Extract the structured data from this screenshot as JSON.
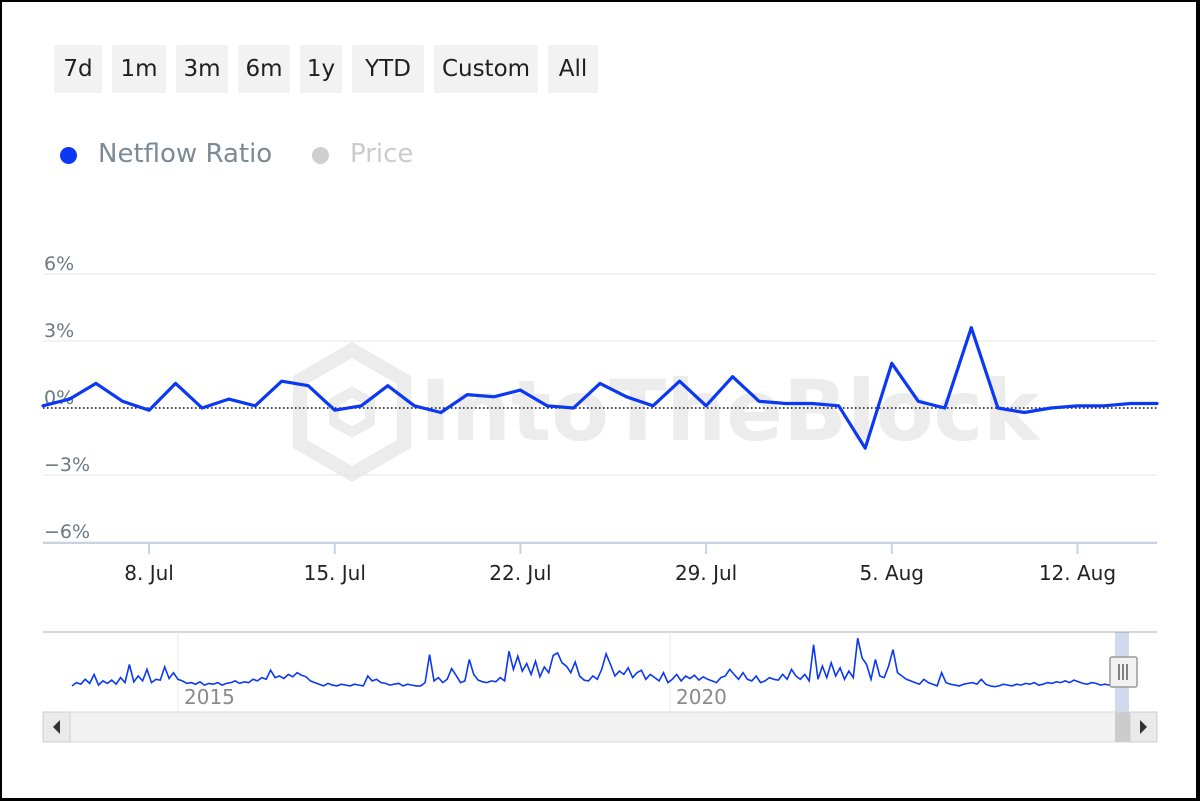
{
  "range_buttons": [
    "7d",
    "1m",
    "3m",
    "6m",
    "1y",
    "YTD",
    "Custom",
    "All"
  ],
  "colors": {
    "netflow": "#0b38f2",
    "price_inactive": "#cfcfcf",
    "legend_text_active": "#7d8a96",
    "legend_text_inactive": "#cccccc",
    "grid": "#e6e6e6",
    "watermark": "#ececec"
  },
  "watermark_text": "IntoTheBlock",
  "chart_data": {
    "type": "line",
    "title": "",
    "xlabel": "",
    "ylabel": "",
    "legend": [
      {
        "name": "Netflow Ratio",
        "active": true
      },
      {
        "name": "Price",
        "active": false
      }
    ],
    "legend_position": "top-left",
    "grid": true,
    "ylim": [
      -6,
      6
    ],
    "y_ticks": [
      6,
      3,
      0,
      -3,
      -6
    ],
    "y_tick_labels": [
      "6%",
      "3%",
      "0%",
      "−3%",
      "−6%"
    ],
    "x_ticks": [
      {
        "date": "2024-07-08",
        "label": "8. Jul"
      },
      {
        "date": "2024-07-15",
        "label": "15. Jul"
      },
      {
        "date": "2024-07-22",
        "label": "22. Jul"
      },
      {
        "date": "2024-07-29",
        "label": "29. Jul"
      },
      {
        "date": "2024-08-05",
        "label": "5. Aug"
      },
      {
        "date": "2024-08-12",
        "label": "12. Aug"
      }
    ],
    "x_range": [
      "2024-07-04",
      "2024-08-15"
    ],
    "reference_line": {
      "y": 0,
      "style": "dotted"
    },
    "series": [
      {
        "name": "Netflow Ratio",
        "points": [
          [
            "2024-07-04",
            0.1
          ],
          [
            "2024-07-05",
            0.4
          ],
          [
            "2024-07-06",
            1.1
          ],
          [
            "2024-07-07",
            0.3
          ],
          [
            "2024-07-08",
            -0.1
          ],
          [
            "2024-07-09",
            1.1
          ],
          [
            "2024-07-10",
            0.0
          ],
          [
            "2024-07-11",
            0.4
          ],
          [
            "2024-07-12",
            0.1
          ],
          [
            "2024-07-13",
            1.2
          ],
          [
            "2024-07-14",
            1.0
          ],
          [
            "2024-07-15",
            -0.1
          ],
          [
            "2024-07-16",
            0.1
          ],
          [
            "2024-07-17",
            1.0
          ],
          [
            "2024-07-18",
            0.1
          ],
          [
            "2024-07-19",
            -0.2
          ],
          [
            "2024-07-20",
            0.6
          ],
          [
            "2024-07-21",
            0.5
          ],
          [
            "2024-07-22",
            0.8
          ],
          [
            "2024-07-23",
            0.1
          ],
          [
            "2024-07-24",
            0.0
          ],
          [
            "2024-07-25",
            1.1
          ],
          [
            "2024-07-26",
            0.5
          ],
          [
            "2024-07-27",
            0.1
          ],
          [
            "2024-07-28",
            1.2
          ],
          [
            "2024-07-29",
            0.1
          ],
          [
            "2024-07-30",
            1.4
          ],
          [
            "2024-07-31",
            0.3
          ],
          [
            "2024-08-01",
            0.2
          ],
          [
            "2024-08-02",
            0.2
          ],
          [
            "2024-08-03",
            0.1
          ],
          [
            "2024-08-04",
            -1.8
          ],
          [
            "2024-08-05",
            2.0
          ],
          [
            "2024-08-06",
            0.3
          ],
          [
            "2024-08-07",
            0.0
          ],
          [
            "2024-08-08",
            3.6
          ],
          [
            "2024-08-09",
            0.0
          ],
          [
            "2024-08-10",
            -0.2
          ],
          [
            "2024-08-11",
            0.0
          ],
          [
            "2024-08-12",
            0.1
          ],
          [
            "2024-08-13",
            0.1
          ],
          [
            "2024-08-14",
            0.2
          ],
          [
            "2024-08-15",
            0.2
          ]
        ]
      }
    ],
    "navigator": {
      "year_labels": [
        "2015",
        "2020"
      ],
      "scrollbar": true,
      "series": [
        2.2,
        2.6,
        2.4,
        3.0,
        2.5,
        3.6,
        2.3,
        2.8,
        2.5,
        2.9,
        2.4,
        3.2,
        2.6,
        4.8,
        2.7,
        3.4,
        2.8,
        4.2,
        2.6,
        3.0,
        2.9,
        4.5,
        3.1,
        3.8,
        3.0,
        2.8,
        2.5,
        2.6,
        2.4,
        2.7,
        2.3,
        2.5,
        2.4,
        2.6,
        2.3,
        2.5,
        2.6,
        2.8,
        2.5,
        2.7,
        2.6,
        3.0,
        2.8,
        3.2,
        3.0,
        4.1,
        3.2,
        3.4,
        3.1,
        3.6,
        3.3,
        3.8,
        3.5,
        3.3,
        2.8,
        2.6,
        2.4,
        2.2,
        2.5,
        2.3,
        2.2,
        2.4,
        2.3,
        2.2,
        2.4,
        2.3,
        2.2,
        3.4,
        2.8,
        3.0,
        2.6,
        2.5,
        2.3,
        2.4,
        2.5,
        2.2,
        2.4,
        2.3,
        2.2,
        2.2,
        2.6,
        6.0,
        2.8,
        3.2,
        2.6,
        3.0,
        4.3,
        3.5,
        2.6,
        2.8,
        5.4,
        3.6,
        2.9,
        2.7,
        2.6,
        2.8,
        2.7,
        3.2,
        2.8,
        6.4,
        4.2,
        5.8,
        4.0,
        4.9,
        3.6,
        5.2,
        3.3,
        4.5,
        3.8,
        5.9,
        6.2,
        5.0,
        4.6,
        3.8,
        5.1,
        3.4,
        2.9,
        2.8,
        3.4,
        3.0,
        4.2,
        6.1,
        4.8,
        3.4,
        4.0,
        3.6,
        4.4,
        3.2,
        3.8,
        4.1,
        3.0,
        3.6,
        3.2,
        2.8,
        3.8,
        2.6,
        3.0,
        3.6,
        2.8,
        3.4,
        3.1,
        3.5,
        2.9,
        3.3,
        3.0,
        2.8,
        2.6,
        3.2,
        3.4,
        4.2,
        3.6,
        3.0,
        3.8,
        3.0,
        2.8,
        3.4,
        2.6,
        2.8,
        3.2,
        3.0,
        2.9,
        3.6,
        3.0,
        4.2,
        3.4,
        3.0,
        3.6,
        2.8,
        7.2,
        3.0,
        4.6,
        3.2,
        5.0,
        3.4,
        4.4,
        3.0,
        4.0,
        3.2,
        8.0,
        5.6,
        4.8,
        3.0,
        5.4,
        3.4,
        3.2,
        4.6,
        6.6,
        3.8,
        3.4,
        3.0,
        2.8,
        2.6,
        2.4,
        3.0,
        2.6,
        2.4,
        2.2,
        3.8,
        2.6,
        2.4,
        2.3,
        2.2,
        2.4,
        2.5,
        2.6,
        2.4,
        3.0,
        2.4,
        2.2,
        2.1,
        2.2,
        2.4,
        2.3,
        2.2,
        2.4,
        2.3,
        2.5,
        2.4,
        2.6,
        2.3,
        2.4,
        2.6,
        2.5,
        2.7,
        2.6,
        2.8,
        2.6,
        2.9,
        2.7,
        2.5,
        2.4,
        2.6,
        2.5,
        2.3,
        2.4,
        2.3,
        2.2,
        2.3,
        2.2,
        2.1
      ]
    }
  }
}
